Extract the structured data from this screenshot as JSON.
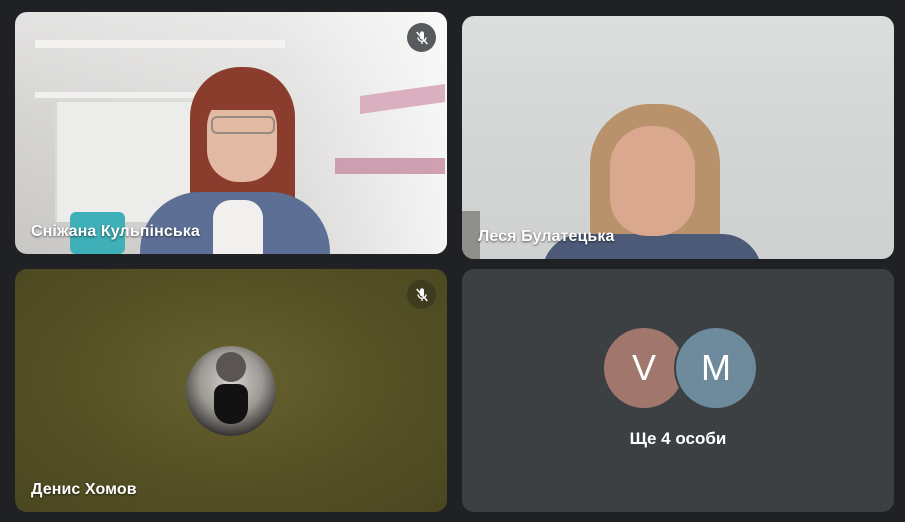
{
  "participants": [
    {
      "name": "Сніжана Кульпінська",
      "muted": true
    },
    {
      "name": "Леся Булатецька",
      "muted": false
    },
    {
      "name": "Денис Хомов",
      "muted": true
    }
  ],
  "overflow": {
    "avatars": [
      {
        "initial": "V",
        "color": "#a1776d"
      },
      {
        "initial": "M",
        "color": "#6d8b9d"
      }
    ],
    "label": "Ще 4 особи"
  },
  "icons": {
    "muted": "mic-off-icon"
  }
}
